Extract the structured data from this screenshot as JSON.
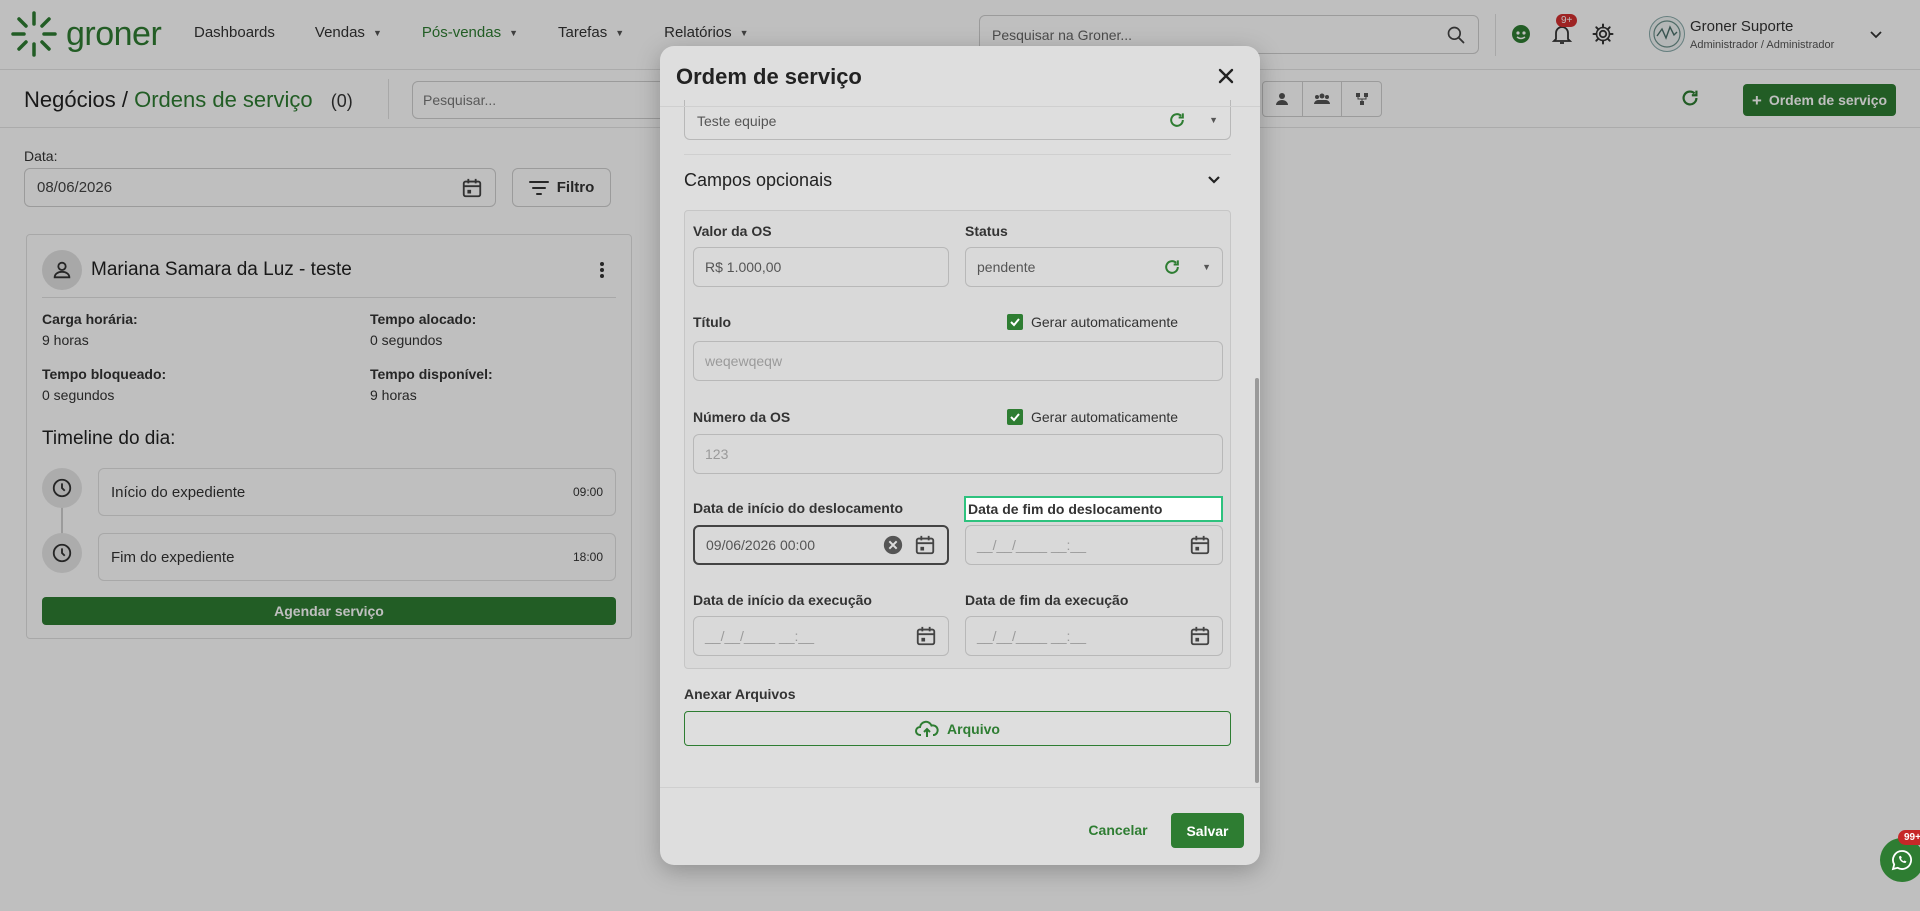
{
  "brand": {
    "name": "groner",
    "color": "#2e7d32"
  },
  "nav": {
    "items": [
      {
        "label": "Dashboards",
        "dropdown": false,
        "active": false
      },
      {
        "label": "Vendas",
        "dropdown": true,
        "active": false
      },
      {
        "label": "Pós-vendas",
        "dropdown": true,
        "active": true
      },
      {
        "label": "Tarefas",
        "dropdown": true,
        "active": false
      },
      {
        "label": "Relatórios",
        "dropdown": true,
        "active": false
      }
    ]
  },
  "global_search": {
    "placeholder": "Pesquisar na Groner..."
  },
  "notifications": {
    "badge": "9+"
  },
  "user": {
    "name": "Groner Suporte",
    "role": "Administrador / Administrador"
  },
  "page": {
    "title_prefix": "Negócios /",
    "title_main": "Ordens de serviço",
    "count": "(0)",
    "search_placeholder": "Pesquisar...",
    "add_button": "Ordem de serviço"
  },
  "filters": {
    "date_label": "Data:",
    "date_value": "08/06/2026",
    "filter_button": "Filtro"
  },
  "person": {
    "name": "Mariana Samara da Luz - teste",
    "stats": {
      "carga_label": "Carga horária:",
      "carga_value": "9 horas",
      "alocado_label": "Tempo alocado:",
      "alocado_value": "0 segundos",
      "bloqueado_label": "Tempo bloqueado:",
      "bloqueado_value": "0 segundos",
      "disponivel_label": "Tempo disponível:",
      "disponivel_value": "9 horas"
    },
    "timeline_title": "Timeline do dia:",
    "timeline": [
      {
        "label": "Início do expediente",
        "time": "09:00"
      },
      {
        "label": "Fim do expediente",
        "time": "18:00"
      }
    ],
    "schedule_button": "Agendar serviço"
  },
  "modal": {
    "title": "Ordem de serviço",
    "equipe_value": "Teste equipe",
    "optional_title": "Campos opcionais",
    "valor_label": "Valor da OS",
    "valor_value": "R$ 1.000,00",
    "status_label": "Status",
    "status_value": "pendente",
    "titulo_label": "Título",
    "titulo_value": "weqewqeqw",
    "auto_label": "Gerar automaticamente",
    "numero_label": "Número da OS",
    "numero_value": "123",
    "inicio_desloc_label": "Data de início do deslocamento",
    "inicio_desloc_value": "09/06/2026 00:00",
    "fim_desloc_label": "Data de fim do deslocamento",
    "date_placeholder": "__/__/____ __:__",
    "inicio_exec_label": "Data de início da execução",
    "fim_exec_label": "Data de fim da execução",
    "attach_label": "Anexar Arquivos",
    "attach_button": "Arquivo",
    "cancel_button": "Cancelar",
    "save_button": "Salvar"
  },
  "whatsapp": {
    "badge": "99+"
  }
}
